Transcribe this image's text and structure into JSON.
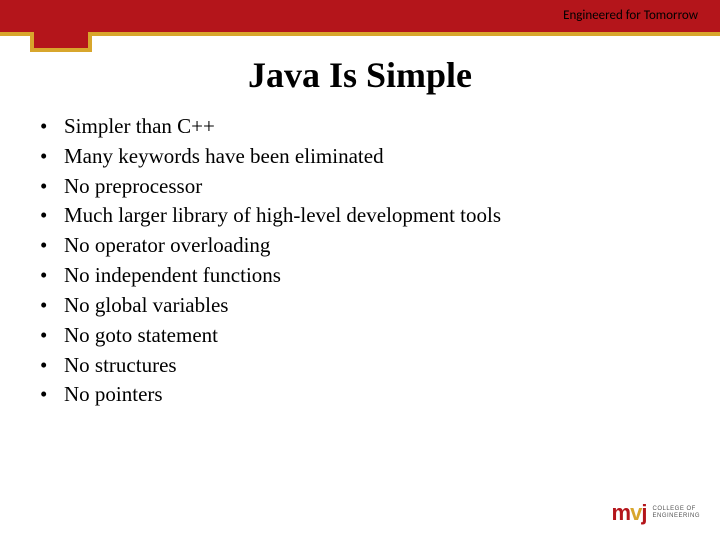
{
  "header": {
    "tagline": "Engineered for Tomorrow"
  },
  "title": "Java Is Simple",
  "bullets": [
    "Simpler than C++",
    "Many keywords have been eliminated",
    "No preprocessor",
    "Much larger library of high-level development tools",
    "No operator overloading",
    "No independent functions",
    "No global variables",
    "No goto statement",
    "No structures",
    "No pointers"
  ],
  "logo": {
    "mark_m": "m",
    "mark_v": "v",
    "mark_j": "j",
    "line1": "COLLEGE OF",
    "line2": "ENGINEERING"
  }
}
